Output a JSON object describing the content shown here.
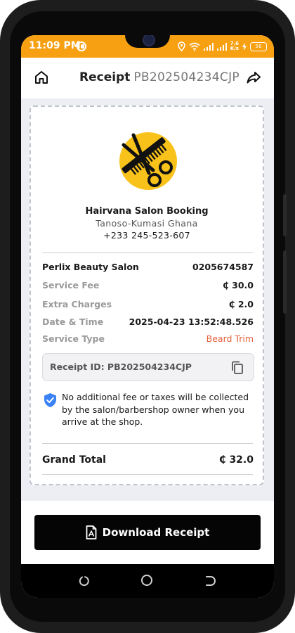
{
  "status_bar": {
    "time": "11:09 PM",
    "net_speed_value": "7.6",
    "net_speed_unit": "K/s",
    "battery": "56"
  },
  "header": {
    "title": "Receipt",
    "receipt_code": "PB202504234CJP",
    "home_icon": "home-icon",
    "share_icon": "share-icon"
  },
  "business": {
    "name": "Hairvana Salon Booking",
    "location": "Tanoso-Kumasi Ghana",
    "phone": "+233 245-523-607",
    "logo_colors": {
      "circle": "#f9c21a",
      "tools": "#111111"
    }
  },
  "details": {
    "salon_name": "Perlix Beauty Salon",
    "salon_phone": "0205674587",
    "rows": [
      {
        "label": "Service Fee",
        "value": "₵ 30.0"
      },
      {
        "label": "Extra Charges",
        "value": "₵ 2.0"
      },
      {
        "label": "Date & Time",
        "value": "2025-04-23 13:52:48.526"
      },
      {
        "label": "Service Type",
        "value": "Beard Trim"
      }
    ]
  },
  "receipt_id": "Receipt ID: PB202504234CJP",
  "notice": "No additional fee or taxes will be collected by the salon/barbershop owner when you arrive at the shop.",
  "grand_total": {
    "label": "Grand Total",
    "value": "₵ 32.0"
  },
  "download_button": {
    "label": "Download Receipt"
  },
  "colors": {
    "status_bar": "#f7a012",
    "accent_text": "#e3613a",
    "shield": "#3b82f6",
    "button_bg": "#050505"
  }
}
